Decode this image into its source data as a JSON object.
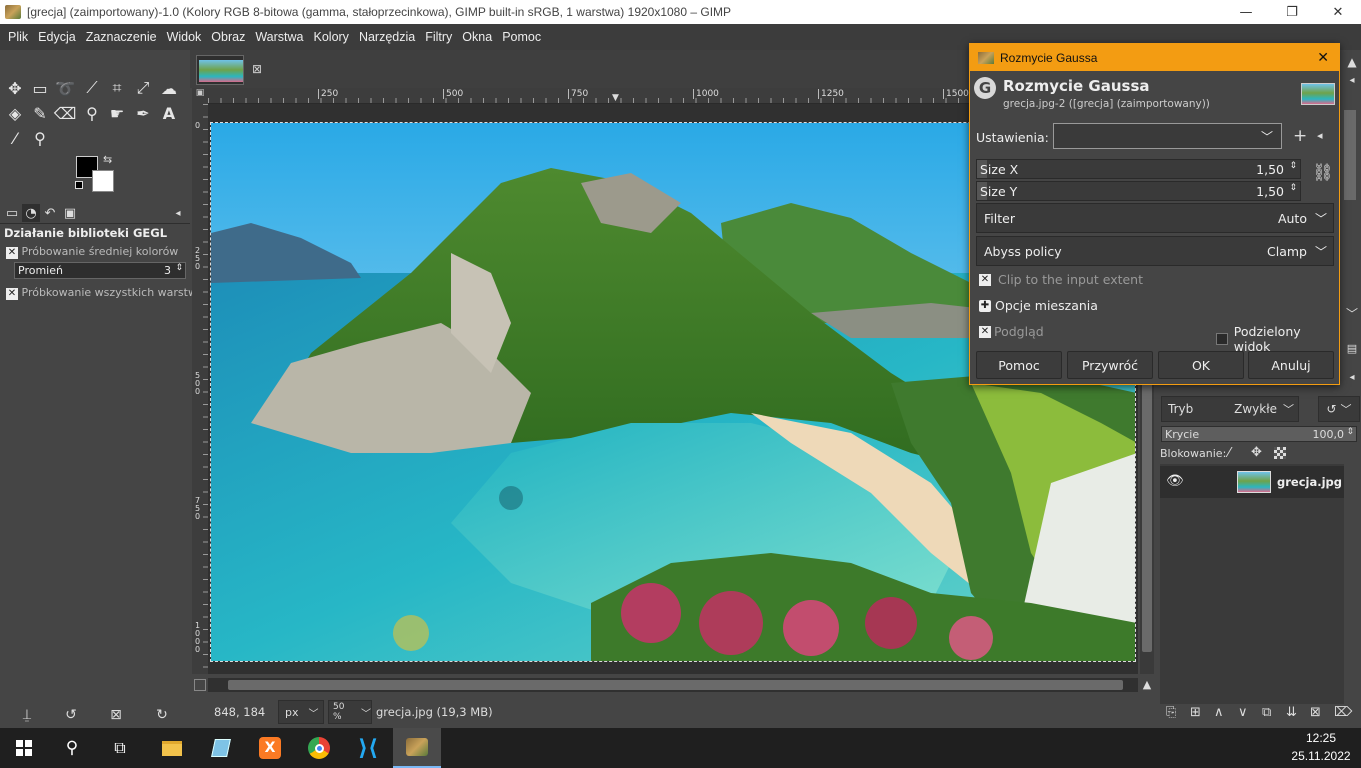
{
  "window": {
    "title": "[grecja] (zaimportowany)-1.0 (Kolory RGB 8-bitowa (gamma, stałoprzecinkowa), GIMP built-in sRGB, 1 warstwa) 1920x1080 – GIMP",
    "minimize": "—",
    "maximize": "❐",
    "close": "✕"
  },
  "menu": [
    "Plik",
    "Edycja",
    "Zaznaczenie",
    "Widok",
    "Obraz",
    "Warstwa",
    "Kolory",
    "Narzędzia",
    "Filtry",
    "Okna",
    "Pomoc"
  ],
  "tool_options": {
    "title": "Działanie biblioteki GEGL",
    "sample_average": "Próbowanie średniej kolorów",
    "radius_label": "Promień",
    "radius_value": "3",
    "sample_merged": "Próbkowanie wszystkich warstw"
  },
  "rulers": {
    "h_ticks": [
      "250",
      "500",
      "750",
      "1000",
      "1250",
      "1500"
    ],
    "v_ticks": [
      "0",
      "2\n5\n0",
      "5\n0\n0",
      "7\n5\n0",
      "1\n0\n0\n0"
    ]
  },
  "status": {
    "coords": "848, 184",
    "unit": "px",
    "zoom": "50 %",
    "file_info": "grecja.jpg (19,3 MB)"
  },
  "dialog": {
    "window_title": "Rozmycie Gaussa",
    "heading": "Rozmycie Gaussa",
    "subtitle": "grecja.jpg-2 ([grecja] (zaimportowany))",
    "presets_label": "Ustawienia:",
    "presets_value": "",
    "size_x_label": "Size X",
    "size_x_value": "1,50",
    "size_y_label": "Size Y",
    "size_y_value": "1,50",
    "filter_label": "Filter",
    "filter_value": "Auto",
    "abyss_label": "Abyss policy",
    "abyss_value": "Clamp",
    "clip_label": "Clip to the input extent",
    "blend_label": "Opcje mieszania",
    "preview_label": "Podgląd",
    "split_label": "Podzielony widok",
    "btn_help": "Pomoc",
    "btn_reset": "Przywróć",
    "btn_ok": "OK",
    "btn_cancel": "Anuluj"
  },
  "layers": {
    "mode_label": "Tryb",
    "mode_value": "Zwykłe",
    "opacity_label": "Krycie",
    "opacity_value": "100,0",
    "lock_label": "Blokowanie:",
    "layer_name": "grecja.jpg"
  },
  "taskbar": {
    "time": "12:25",
    "date": "25.11.2022"
  }
}
